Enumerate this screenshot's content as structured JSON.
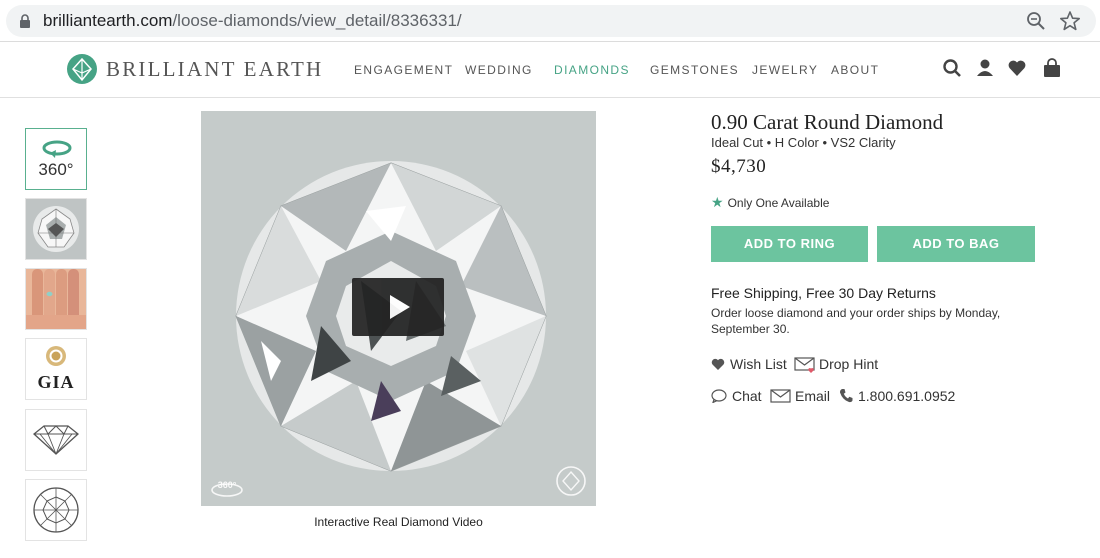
{
  "browser": {
    "url_domain": "brilliantearth.com",
    "url_path": "/loose-diamonds/view_detail/8336331/"
  },
  "header": {
    "brand": "BRILLIANT EARTH",
    "nav": [
      "ENGAGEMENT",
      "WEDDING",
      "DIAMONDS",
      "GEMSTONES",
      "JEWELRY",
      "ABOUT"
    ],
    "active_nav": "DIAMONDS",
    "icons": [
      "search-icon",
      "account-icon",
      "heart-icon",
      "bag-icon"
    ]
  },
  "thumbnails": {
    "items": [
      "360-view",
      "diamond-photo",
      "hand-photo",
      "gia-certificate",
      "diamond-profile-diagram",
      "diamond-top-diagram"
    ],
    "view_360_label": "360°",
    "gia_label": "GIA"
  },
  "video": {
    "caption": "Interactive Real Diamond Video",
    "badge": "360°"
  },
  "product": {
    "title": "0.90 Carat Round Diamond",
    "specs": "Ideal Cut • H Color • VS2 Clarity",
    "price": "$4,730",
    "availability": "Only One Available",
    "add_to_ring": "ADD TO RING",
    "add_to_bag": "ADD TO BAG",
    "shipping": "Free Shipping, Free 30 Day Returns",
    "ship_note": "Order loose diamond and your order ships by Monday, September 30.",
    "wish_list": "Wish List",
    "drop_hint": "Drop Hint",
    "chat": "Chat",
    "email": "Email",
    "phone": "1.800.691.0952"
  },
  "colors": {
    "accent": "#6cc49f",
    "nav_active": "#46a385"
  }
}
